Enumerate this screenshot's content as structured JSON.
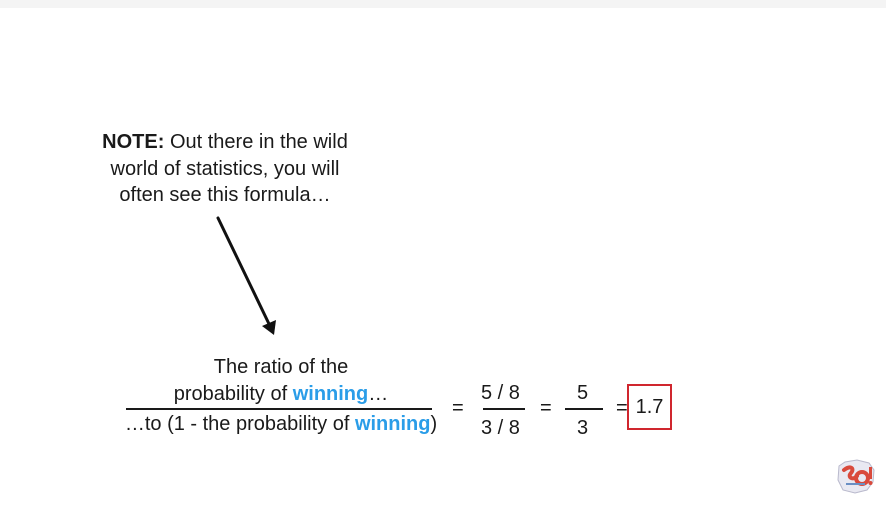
{
  "note": {
    "bold_label": "NOTE:",
    "line1_rest": " Out there in the wild",
    "line2": "world of statistics, you will",
    "line3": "often see this formula…"
  },
  "formula": {
    "numerator_line1": "The ratio of the",
    "numerator_line2_prefix": "probability of ",
    "numerator_highlight": "winning",
    "numerator_line2_suffix": "…",
    "denominator_prefix": "…to (1 - the probability of ",
    "denominator_highlight": "winning",
    "denominator_suffix": ")",
    "eq1": "=",
    "frac2_num": "5 / 8",
    "frac2_den": "3 / 8",
    "eq2": "=",
    "frac3_num": "5",
    "frac3_den": "3",
    "eq3": "=",
    "result": "1.7"
  },
  "colors": {
    "highlight": "#2a9de8",
    "result_border": "#d0262e"
  },
  "logo": {
    "icon": "statquest-so-logo-icon"
  }
}
